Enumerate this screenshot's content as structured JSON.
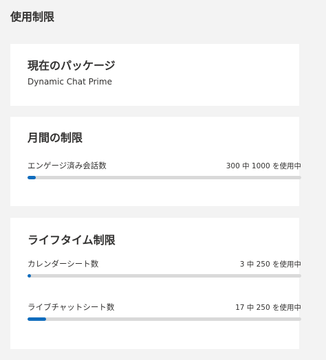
{
  "page": {
    "title": "使用制限"
  },
  "current_package": {
    "title": "現在のパッケージ",
    "name": "Dynamic Chat Prime"
  },
  "monthly_limits": {
    "title": "月間の制限",
    "items": [
      {
        "label": "エンゲージ済み会話数",
        "count_text": "300 中 1000 を使用中",
        "used": 300,
        "limit": 1000,
        "bar_fraction": 0.03
      }
    ]
  },
  "lifetime_limits": {
    "title": "ライフタイム制限",
    "items": [
      {
        "label": "カレンダーシート数",
        "count_text": "3 中 250 を使用中",
        "used": 3,
        "limit": 250,
        "bar_fraction": 0.012
      },
      {
        "label": "ライブチャットシート数",
        "count_text": "17 中 250 を使用中",
        "used": 17,
        "limit": 250,
        "bar_fraction": 0.068
      }
    ]
  },
  "colors": {
    "background": "#f3f3f3",
    "card": "#ffffff",
    "bar_track": "#d9d9d9",
    "bar_fill": "#0f6cbd",
    "text": "#323130"
  }
}
